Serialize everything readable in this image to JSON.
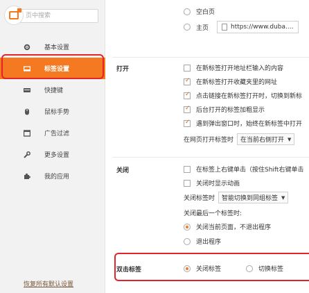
{
  "sidebar": {
    "search_placeholder": "页中搜索",
    "items": [
      {
        "label": "基本设置",
        "icon": "gear-icon"
      },
      {
        "label": "标签设置",
        "icon": "tab-icon",
        "active": true
      },
      {
        "label": "快捷键",
        "icon": "keyboard-icon"
      },
      {
        "label": "鼠标手势",
        "icon": "mouse-icon"
      },
      {
        "label": "广告过滤",
        "icon": "filter-icon"
      },
      {
        "label": "更多设置",
        "icon": "wrench-icon"
      },
      {
        "label": "我的应用",
        "icon": "puzzle-icon"
      }
    ],
    "restore_defaults": "恢复所有默认设置"
  },
  "startup": {
    "blank_label": "空白页",
    "home_label": "主页",
    "home_url": "https://www.duba...."
  },
  "open_section": {
    "title": "打开",
    "options": [
      {
        "label": "在新标签打开地址栏输入的内容",
        "checked": false
      },
      {
        "label": "在新标签打开收藏夹里的网址",
        "checked": true
      },
      {
        "label": "点击链接在新标签打开时，切换到新标",
        "checked": true
      },
      {
        "label": "后台打开的标签加粗显示",
        "checked": true
      },
      {
        "label": "遇到弹出窗口时，始终在新标签中打开",
        "checked": true
      }
    ],
    "open_pos_label": "在网页打开标签时",
    "open_pos_value": "在当前右侧打开"
  },
  "close_section": {
    "title": "关闭",
    "options": [
      {
        "label": "在标签上右键单击（按住Shift右键单击",
        "checked": false
      },
      {
        "label": "关闭时显示动画",
        "checked": false
      }
    ],
    "close_tab_label": "关闭标签时",
    "close_tab_value": "智能切换到同组标签",
    "last_tab_label": "关闭最后一个标签时:",
    "last_tab_options": [
      {
        "label": "关闭当前页面，不退出程序",
        "selected": true
      },
      {
        "label": "退出程序",
        "selected": false
      }
    ]
  },
  "dblclick_section": {
    "title": "双击标签",
    "options": [
      {
        "label": "关闭标签",
        "selected": true
      },
      {
        "label": "切换标签",
        "selected": false
      }
    ]
  },
  "colors": {
    "accent": "#f47920",
    "highlight_ring": "#e0242a"
  }
}
